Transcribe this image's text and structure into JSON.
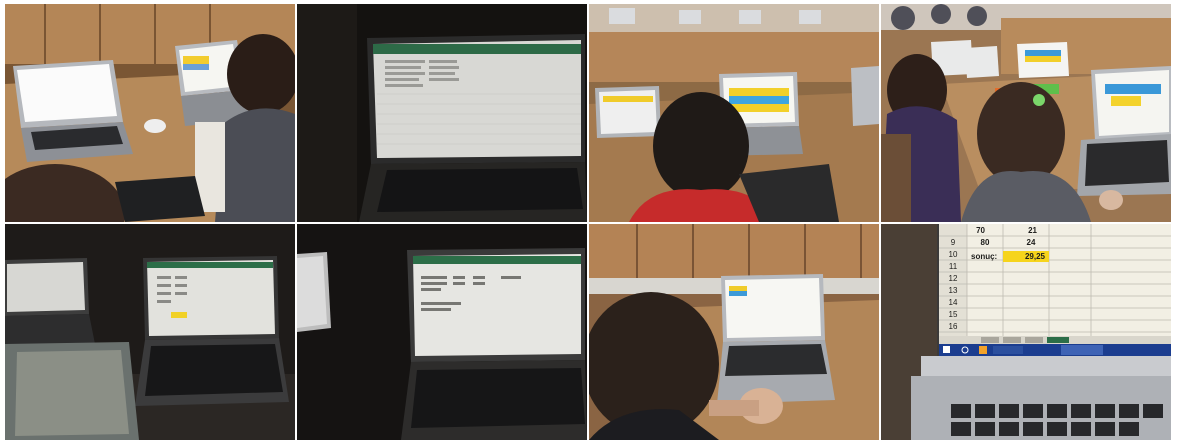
{
  "collage": {
    "tiles": [
      {
        "id": 1,
        "scene": "classroom-laptops"
      },
      {
        "id": 2,
        "scene": "laptop-spreadsheet-dark"
      },
      {
        "id": 3,
        "scene": "student-back-laptop"
      },
      {
        "id": 4,
        "scene": "students-row-laptops"
      },
      {
        "id": 5,
        "scene": "laptops-dim"
      },
      {
        "id": 6,
        "scene": "laptop-table-dark"
      },
      {
        "id": 7,
        "scene": "student-touchpad"
      },
      {
        "id": 8,
        "scene": "spreadsheet-closeup"
      }
    ]
  },
  "closeup": {
    "rows": [
      {
        "num": "",
        "a": "70",
        "b": "21"
      },
      {
        "num": "9",
        "a": "80",
        "b": "24"
      },
      {
        "num": "10",
        "a": "",
        "b": ""
      },
      {
        "num": "11",
        "a": "sonuç:",
        "b": "29,25"
      },
      {
        "num": "12",
        "a": "",
        "b": ""
      },
      {
        "num": "13",
        "a": "",
        "b": ""
      },
      {
        "num": "14",
        "a": "",
        "b": ""
      },
      {
        "num": "15",
        "a": "",
        "b": ""
      },
      {
        "num": "16",
        "a": "",
        "b": ""
      }
    ]
  },
  "colors": {
    "wood": "#a87a4b",
    "dark": "#1c1a18",
    "screen": "#f4f4f0",
    "excel_green": "#217346",
    "highlight_yellow": "#f6d41c",
    "taskbar_blue": "#1b3d8f"
  }
}
